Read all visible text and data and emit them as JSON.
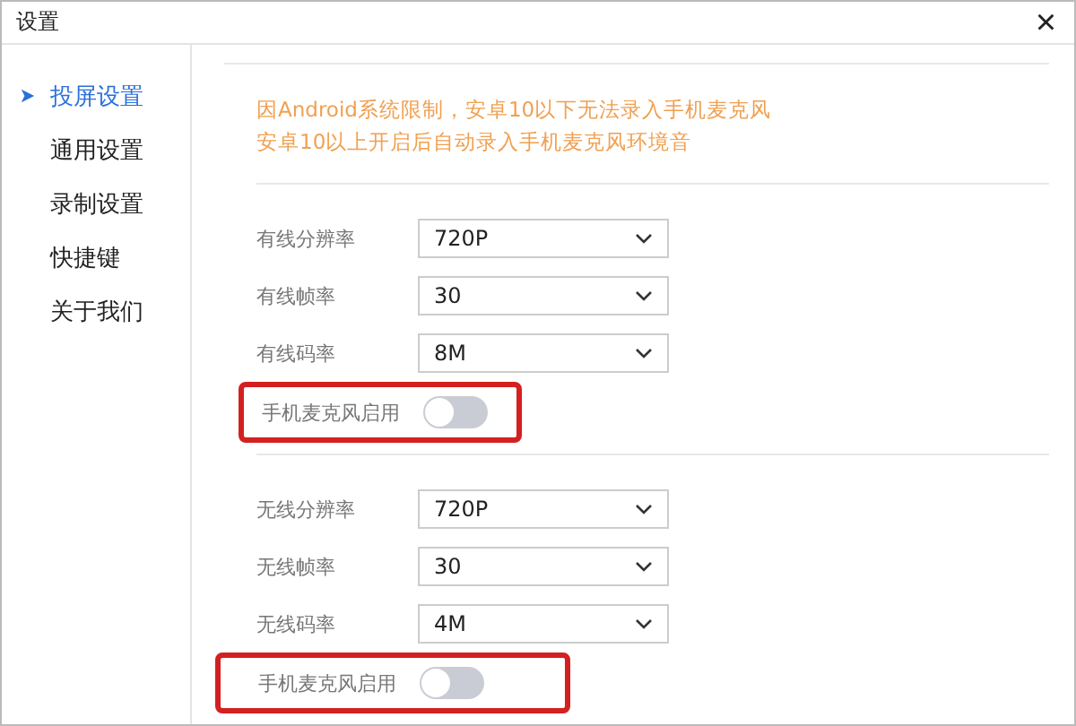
{
  "window": {
    "title": "设置",
    "close": "×"
  },
  "sidebar": {
    "items": [
      {
        "label": "投屏设置",
        "selected": true
      },
      {
        "label": "通用设置",
        "selected": false
      },
      {
        "label": "录制设置",
        "selected": false
      },
      {
        "label": "快捷键",
        "selected": false
      },
      {
        "label": "关于我们",
        "selected": false
      }
    ]
  },
  "notice": [
    "因Android系统限制，安卓10以下无法录入手机麦克风",
    "安卓10以上开启后自动录入手机麦克风环境音"
  ],
  "sections": [
    {
      "rows": [
        {
          "kind": "select",
          "label": "有线分辨率",
          "value": "720P"
        },
        {
          "kind": "select",
          "label": "有线帧率",
          "value": "30"
        },
        {
          "kind": "select",
          "label": "有线码率",
          "value": "8M"
        },
        {
          "kind": "toggle",
          "label": "手机麦克风启用",
          "on": false,
          "highlighted": true
        }
      ]
    },
    {
      "rows": [
        {
          "kind": "select",
          "label": "无线分辨率",
          "value": "720P"
        },
        {
          "kind": "select",
          "label": "无线帧率",
          "value": "30"
        },
        {
          "kind": "select",
          "label": "无线码率",
          "value": "4M"
        },
        {
          "kind": "toggle",
          "label": "手机麦克风启用",
          "on": false,
          "highlighted": true
        }
      ]
    }
  ]
}
